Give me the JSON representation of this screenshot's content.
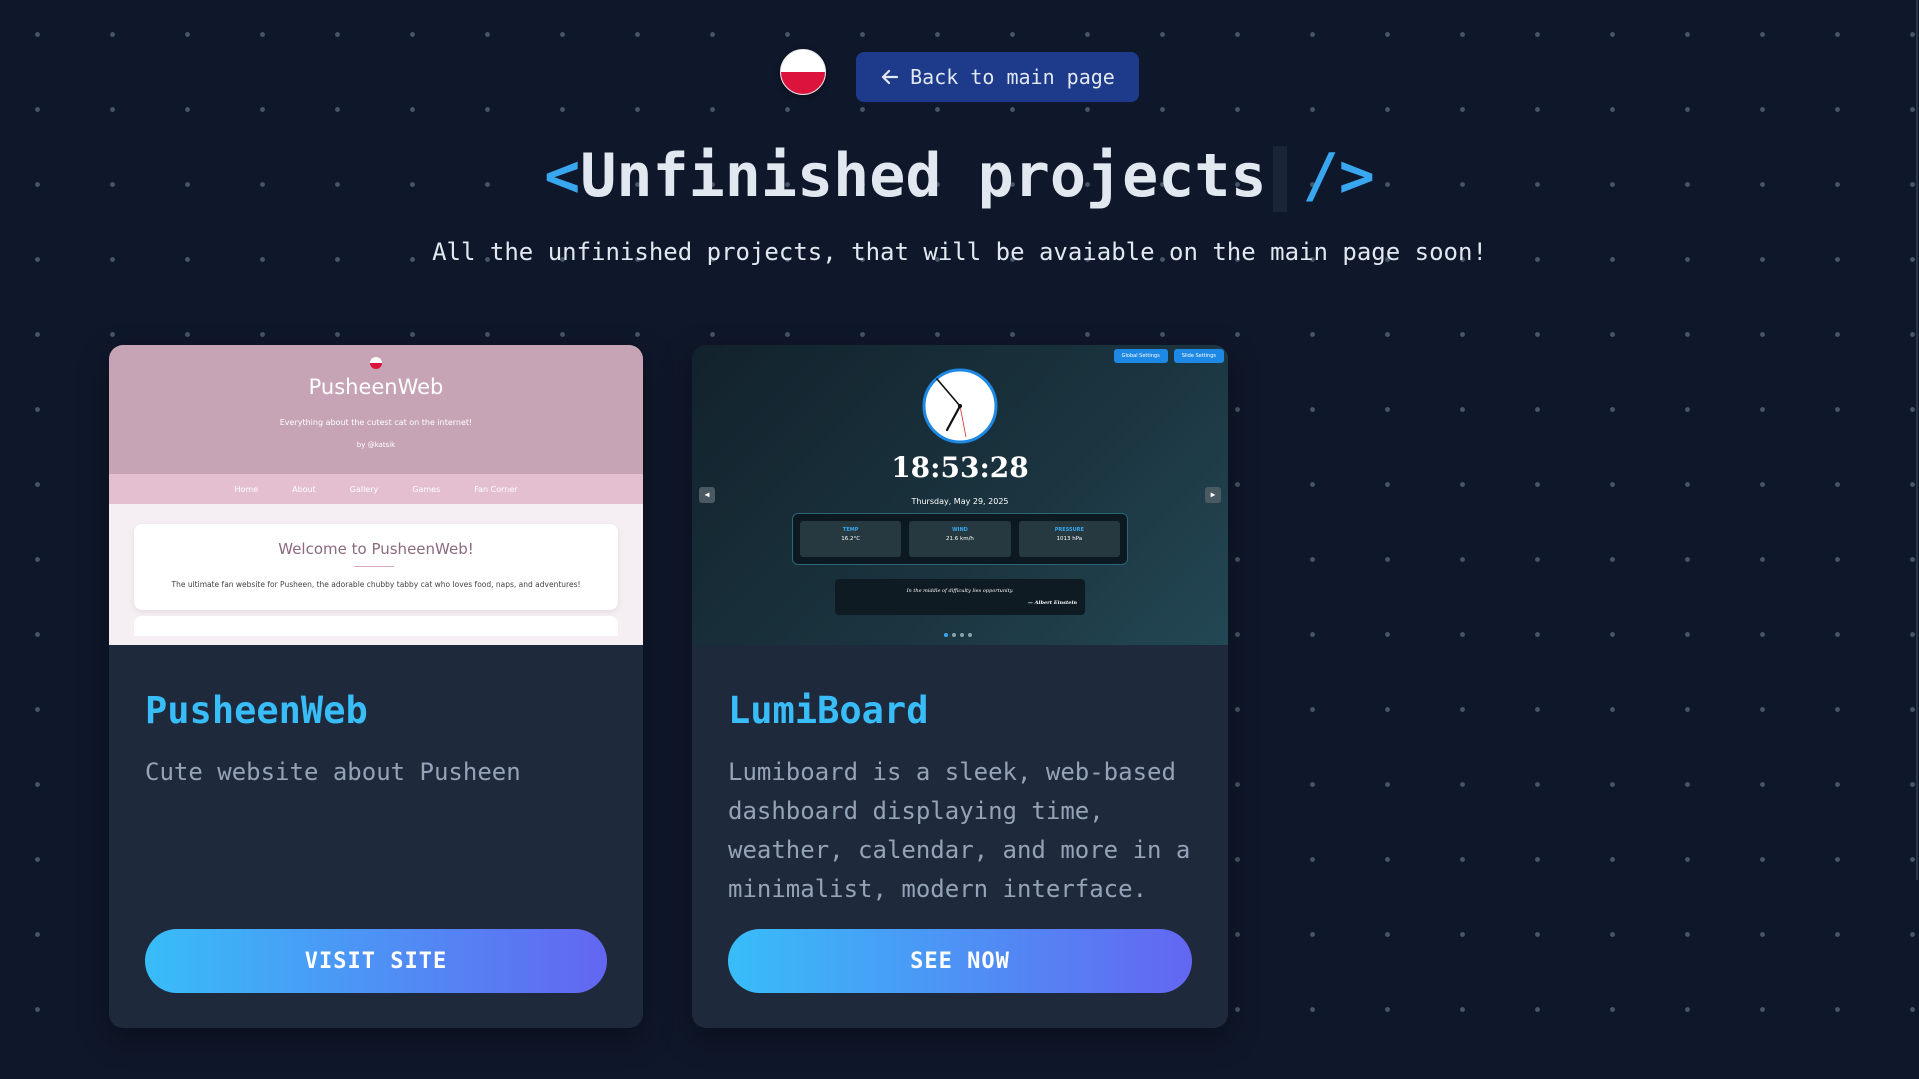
{
  "header": {
    "back_button_label": "Back to main page",
    "language_flag": "flag-pl-icon",
    "title_open": "<",
    "title_text": "Unfinished projects",
    "title_close": "/>",
    "subtitle": "All the unfinished projects, that will be avaiable on the main page soon!"
  },
  "colors": {
    "background": "#0f172a",
    "card_bg": "#1e293b",
    "accent": "#38bdf8",
    "button_gradient_start": "#38bdf8",
    "button_gradient_end": "#6366f1",
    "back_button_bg": "#1e3a8a"
  },
  "projects": [
    {
      "title": "PusheenWeb",
      "description": "Cute website about Pusheen",
      "button_label": "VISIT SITE",
      "preview": {
        "site_title": "PusheenWeb",
        "tagline": "Everything about the cutest cat on the internet!",
        "byline": "by @katsik",
        "nav": [
          "Home",
          "About",
          "Gallery",
          "Games",
          "Fan Corner"
        ],
        "welcome_heading": "Welcome to PusheenWeb!",
        "welcome_text": "The ultimate fan website for Pusheen, the adorable chubby tabby cat who loves food, naps, and adventures!"
      }
    },
    {
      "title": "LumiBoard",
      "description": "Lumiboard is a sleek, web-based dashboard displaying time, weather, calendar, and more in a minimalist, modern interface.",
      "button_label": "SEE NOW",
      "preview": {
        "settings_buttons": [
          "Global Settings",
          "Slide Settings"
        ],
        "time": "18:53:28",
        "date": "Thursday, May 29, 2025",
        "weather": [
          {
            "label": "TEMP",
            "value": "16.2°C"
          },
          {
            "label": "WIND",
            "value": "21.6 km/h"
          },
          {
            "label": "PRESSURE",
            "value": "1013 hPa"
          }
        ],
        "quote": "In the middle of difficulty lies opportunity.",
        "quote_author": "— Albert Einstein",
        "slide_count": 4,
        "active_slide": 1
      }
    }
  ]
}
